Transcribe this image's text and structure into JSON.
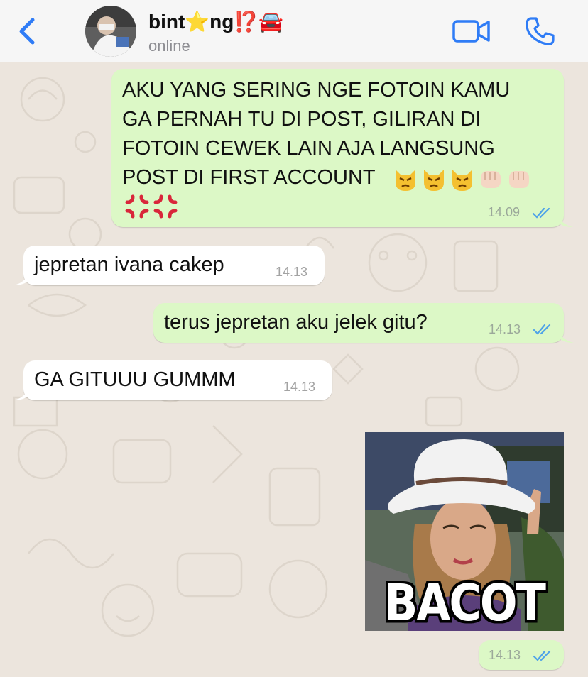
{
  "header": {
    "contact_name": "bint⭐ng⁉️🚘",
    "contact_status": "online",
    "back_icon": "chevron-left-icon",
    "video_icon": "video-camera-icon",
    "call_icon": "phone-icon",
    "accent": "#2F7CF6"
  },
  "messages": [
    {
      "direction": "outgoing",
      "text": "AKU YANG SERING NGE FOTOIN KAMU\nGA PERNAH TU DI POST, GILIRAN DI\nFOTOIN CEWEK LAIN AJA LANGSUNG\nPOST DI FIRST ACCOUNT",
      "emojis": [
        "pouting-cat",
        "pouting-cat",
        "pouting-cat",
        "fist",
        "fist",
        "anger-symbol",
        "anger-symbol"
      ],
      "time": "14.09",
      "status": "read"
    },
    {
      "direction": "incoming",
      "text": "jepretan ivana cakep",
      "time": "14.13"
    },
    {
      "direction": "outgoing",
      "text": "terus jepretan aku jelek gitu?",
      "time": "14.13",
      "status": "read"
    },
    {
      "direction": "incoming",
      "text": "GA GITUUU GUMMM",
      "time": "14.13"
    },
    {
      "direction": "outgoing",
      "type": "image",
      "caption": "BACOT",
      "time": "14.13",
      "status": "read"
    }
  ],
  "colors": {
    "outgoing_bubble": "#DCF8C6",
    "incoming_bubble": "#FFFFFF",
    "chat_background": "#ECE5DD",
    "read_ticks": "#4FA3E8"
  }
}
